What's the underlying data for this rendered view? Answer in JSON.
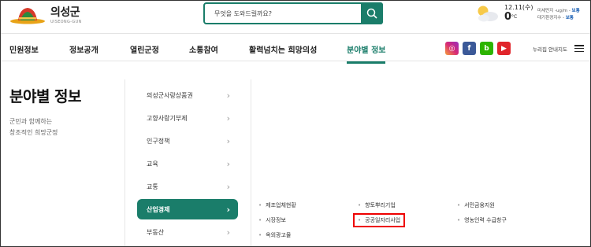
{
  "header": {
    "logo_title": "의성군",
    "logo_sub": "UISEONG-GUN",
    "search_placeholder": "무엇을 도와드릴까요?",
    "weather": {
      "date": "12.11(수)",
      "temp": "0",
      "unit": "°C",
      "air1_label": "미세먼지 -ug/m -",
      "air1_level": "보통",
      "air2_label": "대기환경지수 -",
      "air2_level": "보통"
    }
  },
  "nav": {
    "items": [
      "민원정보",
      "정보공개",
      "열린군정",
      "소통참여",
      "활력넘치는 희망의성",
      "분야별 정보"
    ],
    "sns": {
      "instagram": "◎",
      "facebook": "f",
      "blog": "b",
      "youtube": "▶"
    },
    "sitemap_label": "누리집 안내지도"
  },
  "left": {
    "title": "분야별 정보",
    "slogan_line1": "군민과 함께하는",
    "slogan_line2": "창조적인 희망군정"
  },
  "submenu": {
    "items": [
      "의성군사랑상품권",
      "고향사랑기부제",
      "인구정책",
      "교육",
      "교통",
      "산업경제",
      "부동산"
    ],
    "active_index": 5
  },
  "sublinks": {
    "col1": [
      "제조업체현황",
      "시장정보",
      "옥외광고물"
    ],
    "col2": [
      "향토뿌리기업",
      "공공일자리사업"
    ],
    "col3": [
      "서민금융지원",
      "영농인력 수급창구"
    ],
    "highlighted": "공공일자리사업"
  },
  "colors": {
    "accent": "#1a7d6a",
    "highlight_border": "#ee0000"
  }
}
